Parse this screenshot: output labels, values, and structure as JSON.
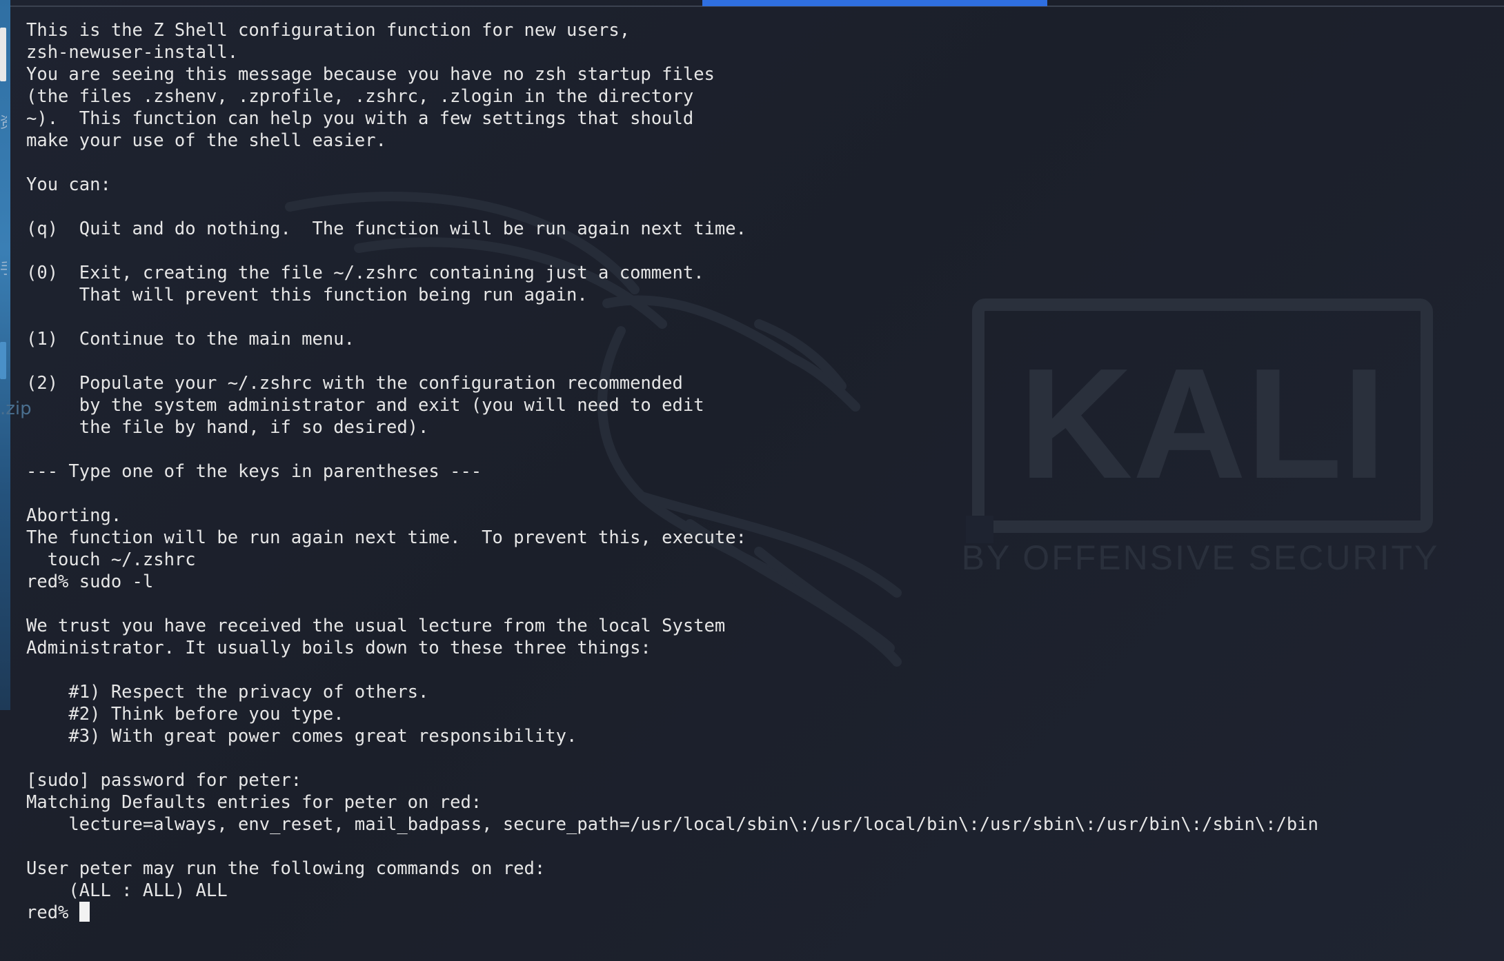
{
  "terminal": {
    "lines": [
      "This is the Z Shell configuration function for new users,",
      "zsh-newuser-install.",
      "You are seeing this message because you have no zsh startup files",
      "(the files .zshenv, .zprofile, .zshrc, .zlogin in the directory",
      "~).  This function can help you with a few settings that should",
      "make your use of the shell easier.",
      "",
      "You can:",
      "",
      "(q)  Quit and do nothing.  The function will be run again next time.",
      "",
      "(0)  Exit, creating the file ~/.zshrc containing just a comment.",
      "     That will prevent this function being run again.",
      "",
      "(1)  Continue to the main menu.",
      "",
      "(2)  Populate your ~/.zshrc with the configuration recommended",
      "     by the system administrator and exit (you will need to edit",
      "     the file by hand, if so desired).",
      "",
      "--- Type one of the keys in parentheses ---",
      "",
      "Aborting.",
      "The function will be run again next time.  To prevent this, execute:",
      "  touch ~/.zshrc",
      "red% sudo -l",
      "",
      "We trust you have received the usual lecture from the local System",
      "Administrator. It usually boils down to these three things:",
      "",
      "    #1) Respect the privacy of others.",
      "    #2) Think before you type.",
      "    #3) With great power comes great responsibility.",
      "",
      "[sudo] password for peter:",
      "Matching Defaults entries for peter on red:",
      "    lecture=always, env_reset, mail_badpass, secure_path=/usr/local/sbin\\:/usr/local/bin\\:/usr/sbin\\:/usr/bin\\:/sbin\\:/bin",
      "",
      "User peter may run the following commands on red:",
      "    (ALL : ALL) ALL"
    ],
    "prompt": "red% "
  },
  "watermark": {
    "brand": "KALI",
    "tagline": "BY OFFENSIVE SECURITY"
  },
  "desktop": {
    "left_fragment_1": "资",
    "left_fragment_2": "手",
    "left_fragment_3": ".zip"
  },
  "colors": {
    "background": "#1b1f29",
    "text": "#e6e6e6",
    "accent": "#2f6fe0",
    "watermark": "#2a303c"
  }
}
